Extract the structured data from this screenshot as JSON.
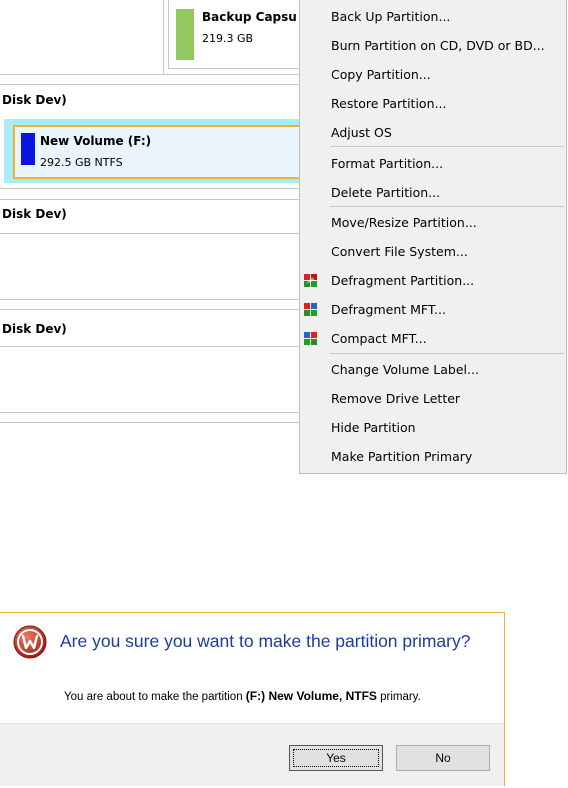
{
  "disk_map": {
    "rows": [
      {
        "partition": {
          "name": "Backup Capsu",
          "size": "219.3 GB",
          "color": "#92c860"
        }
      },
      {
        "label": "Disk Dev)",
        "partition": {
          "name": "New Volume (F:)",
          "size": "292.5 GB NTFS",
          "color": "#0a14e0",
          "selected": true
        }
      },
      {
        "label": "Disk Dev)"
      },
      {
        "label": "Disk Dev)"
      }
    ]
  },
  "context_menu": {
    "items": [
      {
        "label": "Back Up Partition..."
      },
      {
        "label": "Burn Partition on CD, DVD or BD..."
      },
      {
        "label": "Copy Partition..."
      },
      {
        "label": "Restore Partition..."
      },
      {
        "label": "Adjust OS"
      },
      {
        "label": "Format Partition..."
      },
      {
        "label": "Delete Partition..."
      },
      {
        "label": "Move/Resize Partition..."
      },
      {
        "label": "Convert File System..."
      },
      {
        "label": "Defragment Partition...",
        "icon": "defragment-icon"
      },
      {
        "label": "Defragment MFT...",
        "icon": "defragment-mft-icon"
      },
      {
        "label": "Compact MFT...",
        "icon": "compact-mft-icon"
      },
      {
        "label": "Change Volume Label..."
      },
      {
        "label": "Remove Drive Letter"
      },
      {
        "label": "Hide Partition"
      },
      {
        "label": "Make Partition Primary"
      }
    ]
  },
  "dialog": {
    "icon": "question-icon",
    "title": "Are you sure you want to make the partition primary?",
    "message_prefix": "You are about to make the partition ",
    "message_bold": "(F:) New Volume, NTFS",
    "message_suffix": " primary.",
    "yes_label": "Yes",
    "no_label": "No"
  },
  "colors": {
    "accent_border": "#e8b435",
    "selection_bg": "#a9ecf5",
    "title_blue": "#1a3e9e"
  }
}
